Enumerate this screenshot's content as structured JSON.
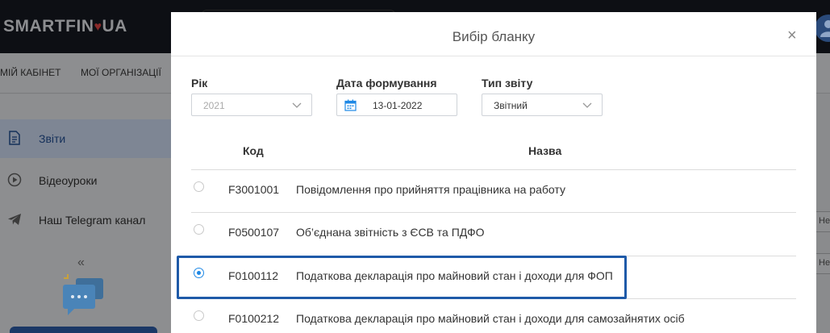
{
  "app": {
    "logo_left": "SMARTFIN",
    "logo_heart": "♥",
    "logo_right": "UA"
  },
  "nav": {
    "items": [
      "МІЙ КАБІНЕТ",
      "МОЇ ОРГАНІЗАЦІЇ"
    ]
  },
  "sidebar": {
    "items": [
      {
        "label": "Звіти",
        "icon": "document-icon",
        "active": true
      },
      {
        "label": "Відеоуроки",
        "icon": "play-icon",
        "active": false
      },
      {
        "label": "Наш Telegram канал",
        "icon": "telegram-icon",
        "active": false
      }
    ],
    "collapse_glyph": "«"
  },
  "right_panel": {
    "field_1": "Не",
    "field_2": "Не"
  },
  "modal": {
    "title": "Вибір бланку",
    "close_glyph": "×",
    "fields": {
      "year": {
        "label": "Рік",
        "value": "2021"
      },
      "date": {
        "label": "Дата формування",
        "value": "13-01-2022"
      },
      "report_type": {
        "label": "Тип звіту",
        "value": "Звітний"
      }
    },
    "table": {
      "columns": [
        "Код",
        "Назва"
      ],
      "rows": [
        {
          "code": "F3001001",
          "name": "Повідомлення про прийняття працівника на работу",
          "selected": false
        },
        {
          "code": "F0500107",
          "name": "Об’єднана звітність з ЄСВ та ПДФО",
          "selected": false
        },
        {
          "code": "F0100112",
          "name": "Податкова декларація про майновий стан і доходи для ФОП",
          "selected": true
        },
        {
          "code": "F0100212",
          "name": "Податкова декларація про майновий стан і доходи для самозайнятих осіб",
          "selected": false
        }
      ]
    }
  },
  "colors": {
    "accent": "#1e88e5",
    "highlight_border": "#1e5aa8"
  }
}
